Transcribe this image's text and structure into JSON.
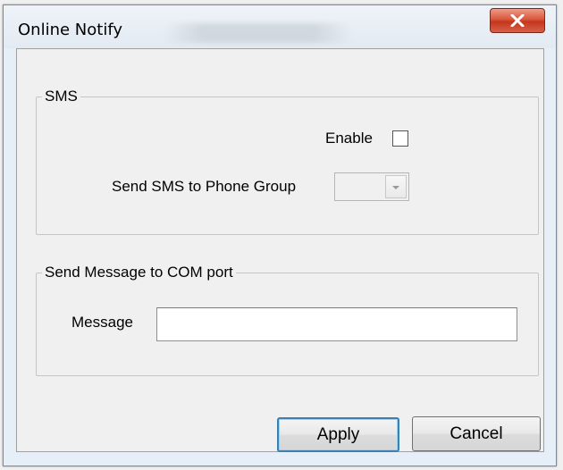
{
  "window": {
    "title": "Online Notify"
  },
  "colors": {
    "window_frame": "#e6eef7",
    "client_bg": "#f0f0f0",
    "close_button": "#c4361d",
    "default_button_border": "#3c7fb1"
  },
  "sms": {
    "legend": "SMS",
    "enable_label": "Enable",
    "enable_checked": false,
    "phone_group_label": "Send SMS to Phone Group",
    "phone_group_value": ""
  },
  "com": {
    "legend": "Send Message to COM port",
    "message_label": "Message",
    "message_value": ""
  },
  "buttons": {
    "apply": "Apply",
    "cancel": "Cancel"
  },
  "icons": {
    "close": "close-icon",
    "dropdown": "chevron-down-icon"
  }
}
